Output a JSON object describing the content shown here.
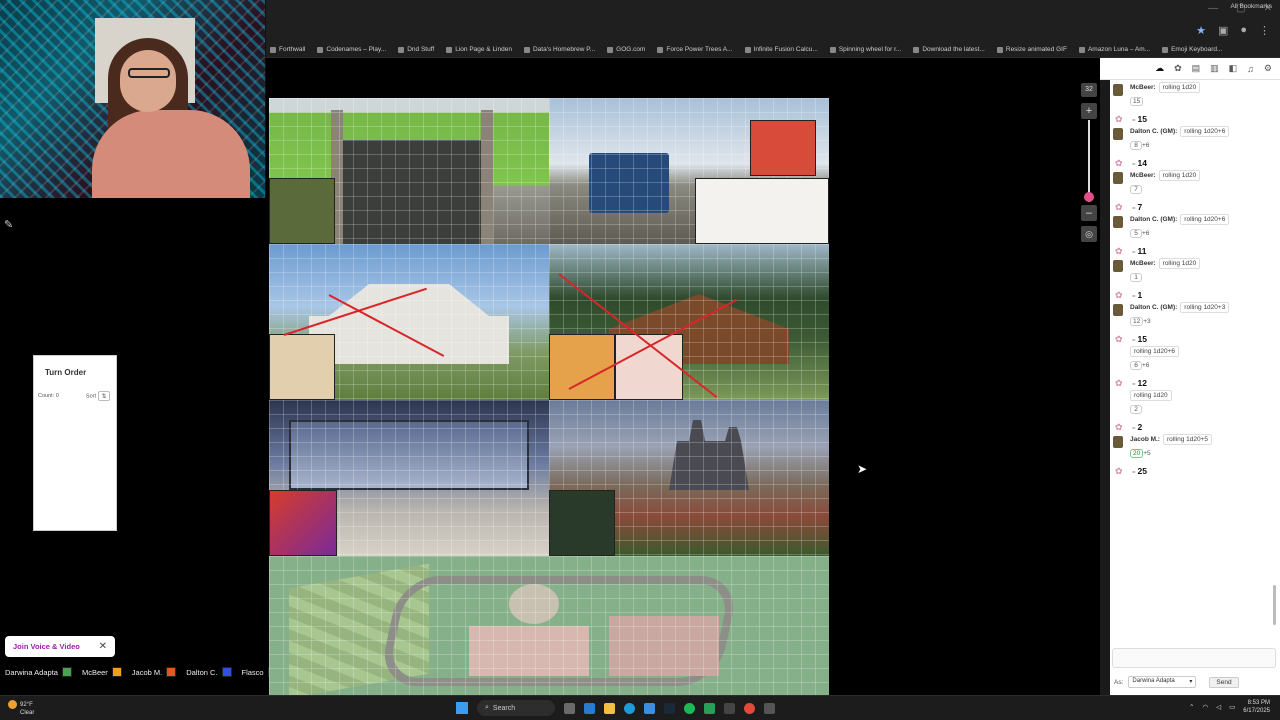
{
  "browser": {
    "bookmarks": [
      "Forthwall",
      "Codenames – Play...",
      "Dnd Stuff",
      "Lion Page & Linden",
      "Data's Homebrew P...",
      "GOG.com",
      "Force Power Trees A...",
      "Infinite Fusion Calcu...",
      "Spinning wheel for r...",
      "Download the latest...",
      "Resize animated GIF",
      "Amazon Luna – Am...",
      "Emoji Keyboard..."
    ],
    "all_bookmarks": "All Bookmarks"
  },
  "turn_order": {
    "title": "Turn Order",
    "count_label": "Count: 0",
    "sort_label": "Sort"
  },
  "voice": {
    "join_label": "Join Voice & Video"
  },
  "players": [
    {
      "name": "Darwina Adapta",
      "color": "#4aa050"
    },
    {
      "name": "McBeer",
      "color": "#f0a020"
    },
    {
      "name": "Jacob M.",
      "color": "#e05a20"
    },
    {
      "name": "Dalton C.",
      "color": "#3050e0"
    },
    {
      "name": "Flasco",
      "color": "#f0e040"
    }
  ],
  "zoom": {
    "value": "32",
    "plus": "+",
    "minus": "–"
  },
  "chat": {
    "messages": [
      {
        "who": "McBeer:",
        "action": "rolling 1d20",
        "dice": [
          "15"
        ],
        "mod": "",
        "total": "15"
      },
      {
        "who": "Dalton C. (GM):",
        "action": "rolling 1d20+6",
        "dice": [
          "8"
        ],
        "mod": "+6",
        "total": "14"
      },
      {
        "who": "McBeer:",
        "action": "rolling 1d20",
        "dice": [
          "7"
        ],
        "mod": "",
        "total": "7"
      },
      {
        "who": "Dalton C. (GM):",
        "action": "rolling 1d20+6",
        "dice": [
          "5"
        ],
        "mod": "+6",
        "total": "11"
      },
      {
        "who": "McBeer:",
        "action": "rolling 1d20",
        "dice": [
          "1"
        ],
        "mod": "",
        "total": "1"
      },
      {
        "who": "Dalton C. (GM):",
        "action": "rolling 1d20+3",
        "dice": [
          "12"
        ],
        "mod": "+3",
        "total": "15"
      },
      {
        "who": "",
        "action": "rolling 1d20+6",
        "dice": [
          "6"
        ],
        "mod": "+6",
        "total": "12"
      },
      {
        "who": "",
        "action": "rolling 1d20",
        "dice": [
          "2"
        ],
        "mod": "",
        "total": "2"
      },
      {
        "who": "Jacob M.:",
        "action": "rolling 1d20+5",
        "dice": [
          "20"
        ],
        "mod": "+5",
        "total": "25",
        "max": true
      }
    ],
    "as_label": "As:",
    "as_value": "Darwina Adapta",
    "send_label": "Send"
  },
  "taskbar": {
    "temp": "92°F",
    "condition": "Clear",
    "search_label": "Search",
    "time": "8:53 PM",
    "date": "6/17/2025"
  }
}
